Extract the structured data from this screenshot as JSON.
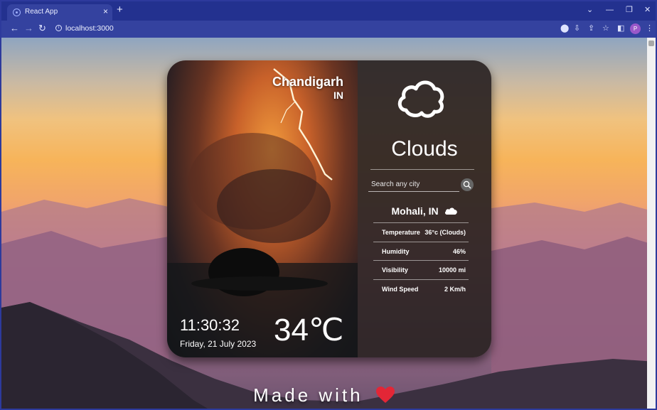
{
  "browser": {
    "tab_title": "React App",
    "tab_close": "×",
    "new_tab": "+",
    "url": "localhost:3000",
    "profile_initial": "P",
    "accent": "#23318f"
  },
  "weather": {
    "city": "Chandigarh",
    "country": "IN",
    "time": "11:30:32",
    "date": "Friday, 21 July 2023",
    "temperature": "34℃",
    "condition": "Clouds",
    "condition_icon": "cloud-icon",
    "search": {
      "placeholder": "Search any city"
    },
    "location": "Mohali, IN",
    "details": [
      {
        "label": "Temperature",
        "value": "36°c (Clouds)"
      },
      {
        "label": "Humidity",
        "value": "46%"
      },
      {
        "label": "Visibility",
        "value": "10000 mi"
      },
      {
        "label": "Wind Speed",
        "value": "2 Km/h"
      }
    ]
  },
  "footer": {
    "text": "Made with"
  }
}
